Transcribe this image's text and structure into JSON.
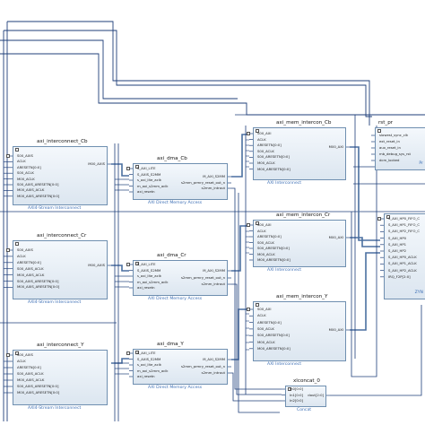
{
  "blocks": {
    "ic_cb": {
      "title": "axi_interconnect_Cb",
      "subtitle": "AXI4-Stream Interconnect",
      "pins_left": [
        "S00_AXIS",
        "ACLK",
        "ARESETN[0:0]",
        "S00_ACLK",
        "M00_ACLK",
        "S00_AXIS_ARESETN[0:0]",
        "M00_AXIS_ACLK",
        "M00_AXIS_ARESETN[0:0]"
      ],
      "pins_right": [
        "M00_AXIS"
      ]
    },
    "ic_cr": {
      "title": "axi_interconnect_Cr",
      "subtitle": "AXI4-Stream Interconnect",
      "pins_left": [
        "S00_AXIS",
        "ACLK",
        "ARESETN[0:0]",
        "S00_AXIS_ACLK",
        "M00_AXIS_ACLK",
        "S00_AXIS_ARESETN[0:0]",
        "M00_AXIS_ARESETN[0:0]"
      ],
      "pins_right": [
        "M00_AXIS"
      ]
    },
    "ic_y": {
      "title": "axi_interconnect_Y",
      "subtitle": "AXI4-Stream Interconnect",
      "pins_left": [
        "S00_AXIS",
        "ACLK",
        "ARESETN[0:0]",
        "S00_AXIS_ACLK",
        "M00_AXIS_ACLK",
        "S00_AXIS_ARESETN[0:0]",
        "M00_AXIS_ARESETN[0:0]"
      ],
      "pins_right": []
    },
    "dma_cb": {
      "title": "axi_dma_Cb",
      "subtitle": "AXI Direct Memory Access",
      "pins_left": [
        "S_AXI_LITE",
        "S_AXIS_S2MM",
        "s_axi_lite_aclk",
        "m_axi_s2mm_aclk",
        "axi_resetn"
      ],
      "pins_right": [
        "M_AXI_S2MM",
        "s2mm_prmry_reset_out_n",
        "s2mm_introut"
      ]
    },
    "dma_cr": {
      "title": "axi_dma_Cr",
      "subtitle": "AXI Direct Memory Access",
      "pins_left": [
        "S_AXI_LITE",
        "S_AXIS_S2MM",
        "s_axi_lite_aclk",
        "m_axi_s2mm_aclk",
        "axi_resetn"
      ],
      "pins_right": [
        "M_AXI_S2MM",
        "s2mm_prmry_reset_out_n",
        "s2mm_introut"
      ]
    },
    "dma_y": {
      "title": "axi_dma_Y",
      "subtitle": "AXI Direct Memory Access",
      "pins_left": [
        "S_AXI_LITE",
        "S_AXIS_S2MM",
        "s_axi_lite_aclk",
        "m_axi_s2mm_aclk",
        "axi_resetn"
      ],
      "pins_right": [
        "M_AXI_S2MM",
        "s2mm_prmry_reset_out_n",
        "s2mm_introut"
      ]
    },
    "mem_cb": {
      "title": "axi_mem_intercon_Cb",
      "subtitle": "AXI Interconnect",
      "pins_left": [
        "S00_AXI",
        "ACLK",
        "ARESETN[0:0]",
        "S00_ACLK",
        "S00_ARESETN[0:0]",
        "M00_ACLK",
        "M00_ARESETN[0:0]"
      ],
      "pins_right": [
        "M00_AXI"
      ]
    },
    "mem_cr": {
      "title": "axi_mem_intercon_Cr",
      "subtitle": "AXI Interconnect",
      "pins_left": [
        "S00_AXI",
        "ACLK",
        "ARESETN[0:0]",
        "S00_ACLK",
        "S00_ARESETN[0:0]",
        "M00_ACLK",
        "M00_ARESETN[0:0]"
      ],
      "pins_right": [
        "M00_AXI"
      ]
    },
    "mem_y": {
      "title": "axi_mem_intercon_Y",
      "subtitle": "AXI Interconnect",
      "pins_left": [
        "S00_AXI",
        "ACLK",
        "ARESETN[0:0]",
        "S00_ACLK",
        "S00_ARESETN[0:0]",
        "M00_ACLK",
        "M00_ARESETN[0:0]"
      ],
      "pins_right": [
        "M00_AXI"
      ]
    },
    "rst": {
      "title": "rst_pr",
      "subtitle": "Pr",
      "pins_left": [
        "slowest_sync_clk",
        "ext_reset_in",
        "aux_reset_in",
        "mb_debug_sys_rst",
        "dcm_locked"
      ],
      "pins_right": []
    },
    "ps": {
      "title": "",
      "subtitle": "ZYN",
      "pins_left": [
        "S_AXI_HP0_FIFO_C",
        "S_AXI_HP1_FIFO_C",
        "S_AXI_HP2_FIFO_C",
        "S_AXI_HP0",
        "S_AXI_HP1",
        "S_AXI_HP2",
        "S_AXI_HP0_ACLK",
        "S_AXI_HP1_ACLK",
        "S_AXI_HP2_ACLK",
        "IRQ_F2P[2:0]"
      ],
      "pins_right": []
    },
    "concat": {
      "title": "xlconcat_0",
      "subtitle": "Concat",
      "pins_left": [
        "In0[0:0]",
        "In1[0:0]",
        "In2[0:0]"
      ],
      "pins_right": [
        "dout[2:0]"
      ]
    }
  },
  "colors": {
    "wire": "#1f3f7a",
    "bus": "#4a6fa0",
    "block_border": "#6f8fb0",
    "subtitle": "#3d6fb5"
  }
}
